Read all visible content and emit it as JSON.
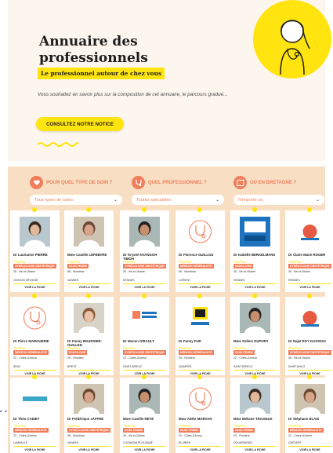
{
  "hero": {
    "title": "Annuaire des professionnels",
    "subtitle": "Le professionnel autour de chez vous",
    "description": "Vous souhaitez en savoir plus sur la composition de cet annuaire, le parcours gradué...",
    "notice_button": "CONSULTEZ NOTRE NOTICE"
  },
  "filters": [
    {
      "label": "POUR QUEL TYPE DE SOIN ?",
      "value": "Tous types de soins",
      "icon": "care-icon"
    },
    {
      "label": "QUEL PROFESSIONNEL ?",
      "value": "Toutes spécialités",
      "icon": "stethoscope-icon"
    },
    {
      "label": "OÙ EN BRETAGNE ?",
      "value": "N'importe où",
      "icon": "map-icon"
    }
  ],
  "cards": [
    {
      "name": "Dr Laurianne PIERRE",
      "tag": "GYNÉCOLOGIE OBSTÉTRIQUE",
      "loc": "35 - Ille-et-Vilaine",
      "city": "CESSON SÉVIGNÉ",
      "link": "VOIR LA FICHE",
      "photo": "doctor-photo-icon"
    },
    {
      "name": "Mme Camille LEFEBVRE",
      "tag": "SAGE-FEMME",
      "loc": "56 - Morbihan",
      "city": "VANNES",
      "link": "VOIR LA FICHE",
      "photo": "doctor-photo-icon"
    },
    {
      "name": "Dr Krystel NYANGOH TIMOH",
      "tag": "GYNÉCOLOGIE OBSTÉTRIQUE",
      "loc": "35 - Ille-et-Vilaine",
      "city": "RENNES",
      "link": "VOIR LA FICHE",
      "photo": "doctor-photo-icon"
    },
    {
      "name": "Dr Florence GUILLOU",
      "tag": "MÉDECIN GÉNÉRALISTE",
      "loc": "56 - Morbihan",
      "city": "LORIENT",
      "link": "VOIR LA FICHE",
      "photo": "stethoscope-icon"
    },
    {
      "name": "Dr Isabelle BERKELMANS",
      "tag": "RADIOLOGIE",
      "loc": "35 - Ille-et-Vilaine",
      "city": "RENNES",
      "link": "VOIR LA FICHE",
      "photo": "chu-rennes-logo"
    },
    {
      "name": "Dr Claire Marie ROGER",
      "tag": "GYNÉCOLOGIE OBSTÉTRIQUE",
      "loc": "35 - Ille-et-Vilaine",
      "city": "RENNES",
      "link": "VOIR LA FICHE",
      "photo": "clinic-logo"
    },
    {
      "name": "Dr Pierre MARGUERIE",
      "tag": "MÉDECIN GÉNÉRALISTE",
      "loc": "22 - Côtes-d'Armor",
      "city": "BINIC",
      "link": "VOIR LA FICHE",
      "photo": "stethoscope-icon"
    },
    {
      "name": "Dr Fanny BOURSIER-GUILLEN",
      "tag": "RADIOLOGIE",
      "loc": "29 - Finistère",
      "city": "BREST",
      "link": "VOIR LA FICHE",
      "photo": "doctor-photo-icon"
    },
    {
      "name": "Dr Manon GIRAULT",
      "tag": "GYNÉCOLOGIE OBSTÉTRIQUE",
      "loc": "22 - Côtes-d'Armor",
      "city": "SAINT-BRIEUC",
      "link": "VOIR LA FICHE",
      "photo": "hospital-logo"
    },
    {
      "name": "Dr Fanny FUR",
      "tag": "MÉDECIN GÉNÉRALISTE",
      "loc": "29 - Finistère",
      "city": "QUIMPER",
      "link": "VOIR LA FICHE",
      "photo": "finistere-logo"
    },
    {
      "name": "Mme Solène DUPONT",
      "tag": "SAGE-FEMME",
      "loc": "22 - Côtes-d'Armor",
      "city": "SAINT-BRIEUC",
      "link": "VOIR LA FICHE",
      "photo": "doctor-photo-icon"
    },
    {
      "name": "Dr Najat ROY DASSIOU",
      "tag": "GYNÉCOLOGIE OBSTÉTRIQUE",
      "loc": "35 - Ille-et-Vilaine",
      "city": "SAINT-MALO",
      "link": "VOIR LA FICHE",
      "photo": "clinic-logo"
    },
    {
      "name": "Dr Théo CADIET",
      "tag": "MÉDECIN GÉNÉRALISTE",
      "loc": "22 - Côtes-d'Armor",
      "city": "LAMBALLE",
      "link": "VOIR LA FICHE",
      "photo": "kersante-logo"
    },
    {
      "name": "Dr Frédérique JAFFRÉ",
      "tag": "GYNÉCOLOGIE OBSTÉTRIQUE",
      "loc": "56 - Morbihan",
      "city": "VANNES",
      "link": "VOIR LA FICHE",
      "photo": "doctor-photo-icon"
    },
    {
      "name": "Mme Camille REYÉ",
      "tag": "SAGE-FEMME",
      "loc": "35 - Ille-et-Vilaine",
      "city": "LOCMARIA PLOUZANÉ",
      "link": "VOIR LA FICHE",
      "photo": "doctor-photo-icon"
    },
    {
      "name": "Mme Adèle MORVAN",
      "tag": "SAGE-FEMME",
      "loc": "22 - Côtes-d'Armor",
      "city": "PLURIEN",
      "link": "VOIR LA FICHE",
      "photo": "woman-icon"
    },
    {
      "name": "Mme Mélanie TRAISEUX",
      "tag": "SAGE-FEMME",
      "loc": "29 - Finistère",
      "city": "DOUARNENEZ",
      "link": "VOIR LA FICHE",
      "photo": "doctor-photo-icon"
    },
    {
      "name": "Dr Stéphane BLAIS",
      "tag": "MÉDECIN GÉNÉRALISTE",
      "loc": "22 - Côtes-d'Armor",
      "city": "QUÉVERT",
      "link": "VOIR LA FICHE",
      "photo": "doctor-photo-icon"
    }
  ],
  "colors": {
    "accent": "#f07e5b",
    "yellow": "#ffe40f",
    "beige": "#f8dfc4",
    "hero_bg": "#fdf6ee"
  }
}
